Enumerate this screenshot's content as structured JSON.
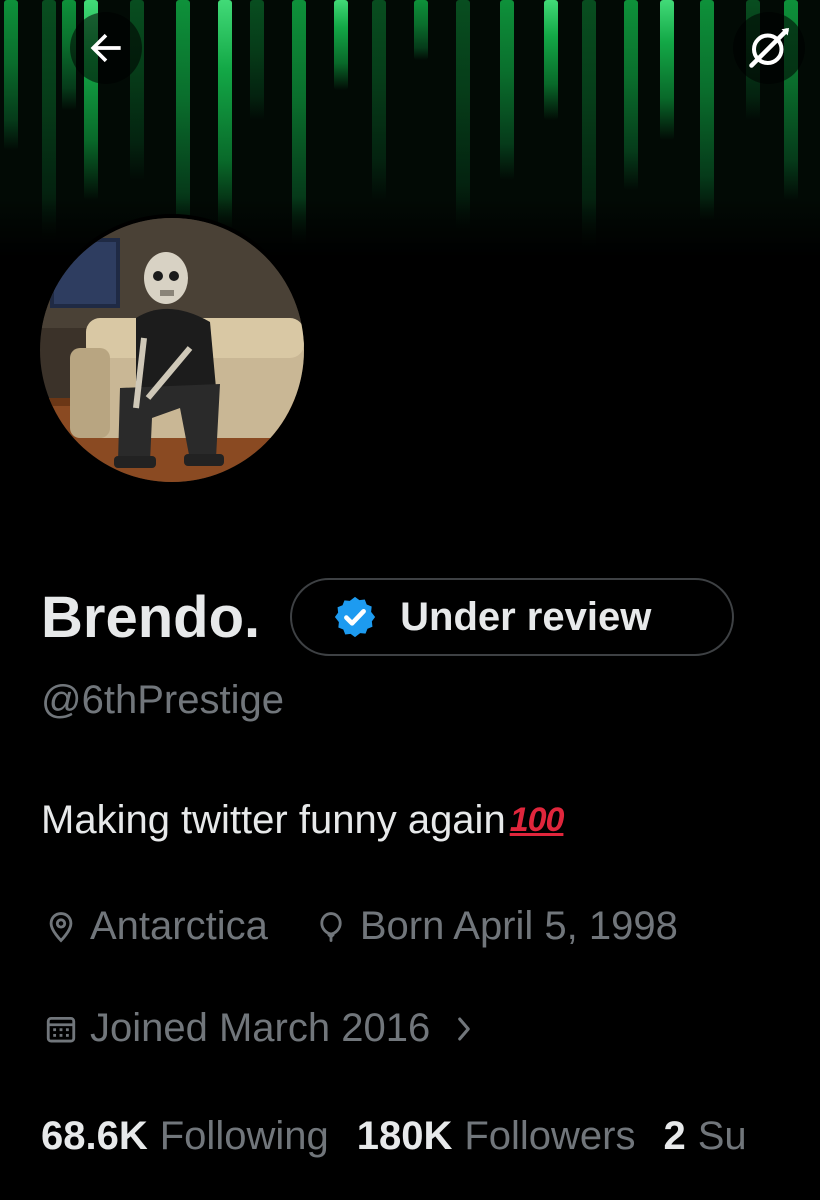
{
  "profile": {
    "display_name": "Brendo.",
    "status_label": "Under review",
    "handle": "@6thPrestige",
    "bio": "Making twitter funny again",
    "bio_emoji": "100",
    "location": "Antarctica",
    "birthday": "Born April 5, 1998",
    "joined": "Joined March 2016"
  },
  "stats": {
    "following_count": "68.6K",
    "following_label": "Following",
    "followers_count": "180K",
    "followers_label": "Followers",
    "subscriptions_count": "2",
    "subscriptions_label": "Su"
  },
  "icons": {
    "back": "arrow-left-icon",
    "grok": "grok-icon",
    "verified": "verified-badge-icon",
    "location": "location-pin-icon",
    "birthday": "balloon-icon",
    "joined": "calendar-icon",
    "chevron": "chevron-right-icon"
  },
  "colors": {
    "background": "#000000",
    "text_primary": "#e7e9ea",
    "text_secondary": "#71767b",
    "verified_blue": "#1d9bf0",
    "pill_border": "#3e4144",
    "banner_green": "#16c452",
    "emoji_red": "#e0263c"
  }
}
